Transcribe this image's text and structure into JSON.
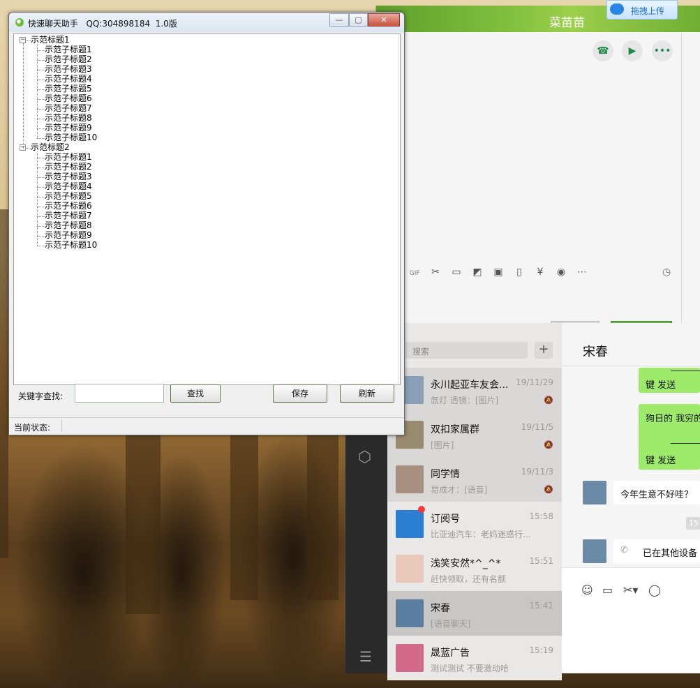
{
  "app": {
    "title": "快速聊天助手   QQ:304898184  1.0版",
    "window_controls": {
      "minimize": "—",
      "maximize": "▢",
      "close": "✕"
    },
    "tree": [
      {
        "label": "示范标题1",
        "expanded": true,
        "children": [
          "示范子标题1",
          "示范子标题2",
          "示范子标题3",
          "示范子标题4",
          "示范子标题5",
          "示范子标题6",
          "示范子标题7",
          "示范子标题8",
          "示范子标题9",
          "示范子标题10"
        ]
      },
      {
        "label": "示范标题2",
        "expanded": true,
        "children": [
          "示范子标题1",
          "示范子标题2",
          "示范子标题3",
          "示范子标题4",
          "示范子标题5",
          "示范子标题6",
          "示范子标题7",
          "示范子标题8",
          "示范子标题9",
          "示范子标题10"
        ]
      }
    ],
    "search_label": "关键字查找:",
    "search_value": "",
    "find_button": "查找",
    "save_button": "保存",
    "refresh_button": "刷新",
    "status_label": "当前状态:",
    "status_value": ""
  },
  "qq": {
    "title": "菜苗苗",
    "upload_label": "拖拽上传",
    "call_icons": [
      "phone-icon",
      "video-icon",
      "more-icon"
    ],
    "toolbar_icons": [
      "gif-icon",
      "scissors-icon",
      "folder-icon",
      "dice-icon",
      "image-icon",
      "shake-icon",
      "red-packet-icon",
      "music-icon",
      "more-icon"
    ],
    "toolbar_glyphs": [
      "GIF",
      "✂",
      "▭",
      "◩",
      "▣",
      "▯",
      "¥",
      "◉",
      "⋯"
    ],
    "history_icon": "clock-icon"
  },
  "wechat": {
    "search_placeholder": "搜索",
    "add_label": "+",
    "chats": [
      {
        "name": "永川起亚车友会...",
        "time": "19/11/29",
        "message": "氙灯  透镜：[图片]",
        "muted": true,
        "unread": false
      },
      {
        "name": "双扣家属群",
        "time": "19/11/5",
        "message": "[图片]",
        "muted": true,
        "unread": false
      },
      {
        "name": "同学情",
        "time": "19/11/3",
        "message": "易成才：[语音]",
        "muted": true,
        "unread": false
      },
      {
        "name": "订阅号",
        "time": "15:58",
        "message": "比亚迪汽车：老妈迷惑行...",
        "muted": false,
        "unread": true
      },
      {
        "name": "浅笑安然*^_^*",
        "time": "15:51",
        "message": "赶快领取，还有名额",
        "muted": false,
        "unread": false
      },
      {
        "name": "宋春",
        "time": "15:41",
        "message": "[语音聊天]",
        "muted": false,
        "unread": false,
        "selected": true
      },
      {
        "name": "晟蓝广告",
        "time": "15:19",
        "message": "测试测试  不要激动哈",
        "muted": false,
        "unread": false
      }
    ],
    "mute_glyph": "🔕",
    "chat_title": "宋春",
    "messages": {
      "out_1": "键 发送",
      "out_2_line1": "狗日的 我穷的",
      "out_2_line2": "键 发送",
      "in_1": "今年生意不好哇？",
      "time_chip": "15",
      "in_2": "已在其他设备"
    },
    "input_icons": [
      "☺",
      "▭",
      "✂▾",
      "◯"
    ]
  },
  "colors": {
    "wechat_green_bubble": "#9eea6a",
    "wechat_sidebar": "#2a2a2a",
    "button_border": "#557a45"
  }
}
